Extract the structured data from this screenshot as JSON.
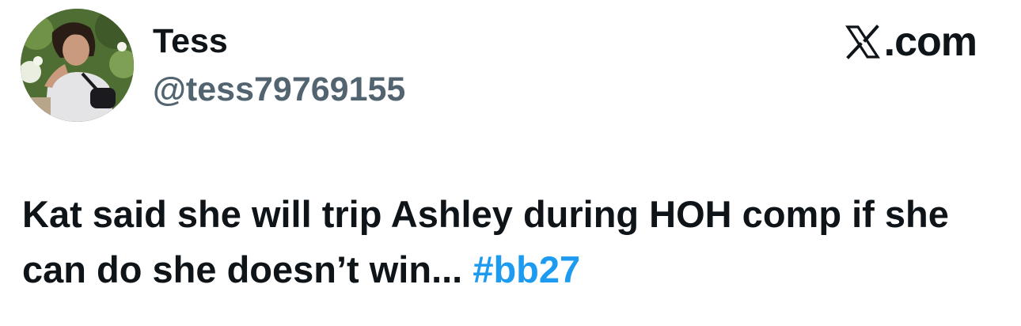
{
  "author": {
    "display_name": "Tess",
    "handle": "@tess79769155"
  },
  "site": {
    "label": ".com",
    "logo_icon": "x-logo-icon"
  },
  "tweet": {
    "body": "Kat said she will trip Ashley during HOH comp if she can do she doesn’t win...",
    "hashtag": "#bb27"
  },
  "colors": {
    "text_primary": "#0f1419",
    "text_secondary": "#536471",
    "link": "#1d9bf0",
    "background": "#ffffff"
  }
}
